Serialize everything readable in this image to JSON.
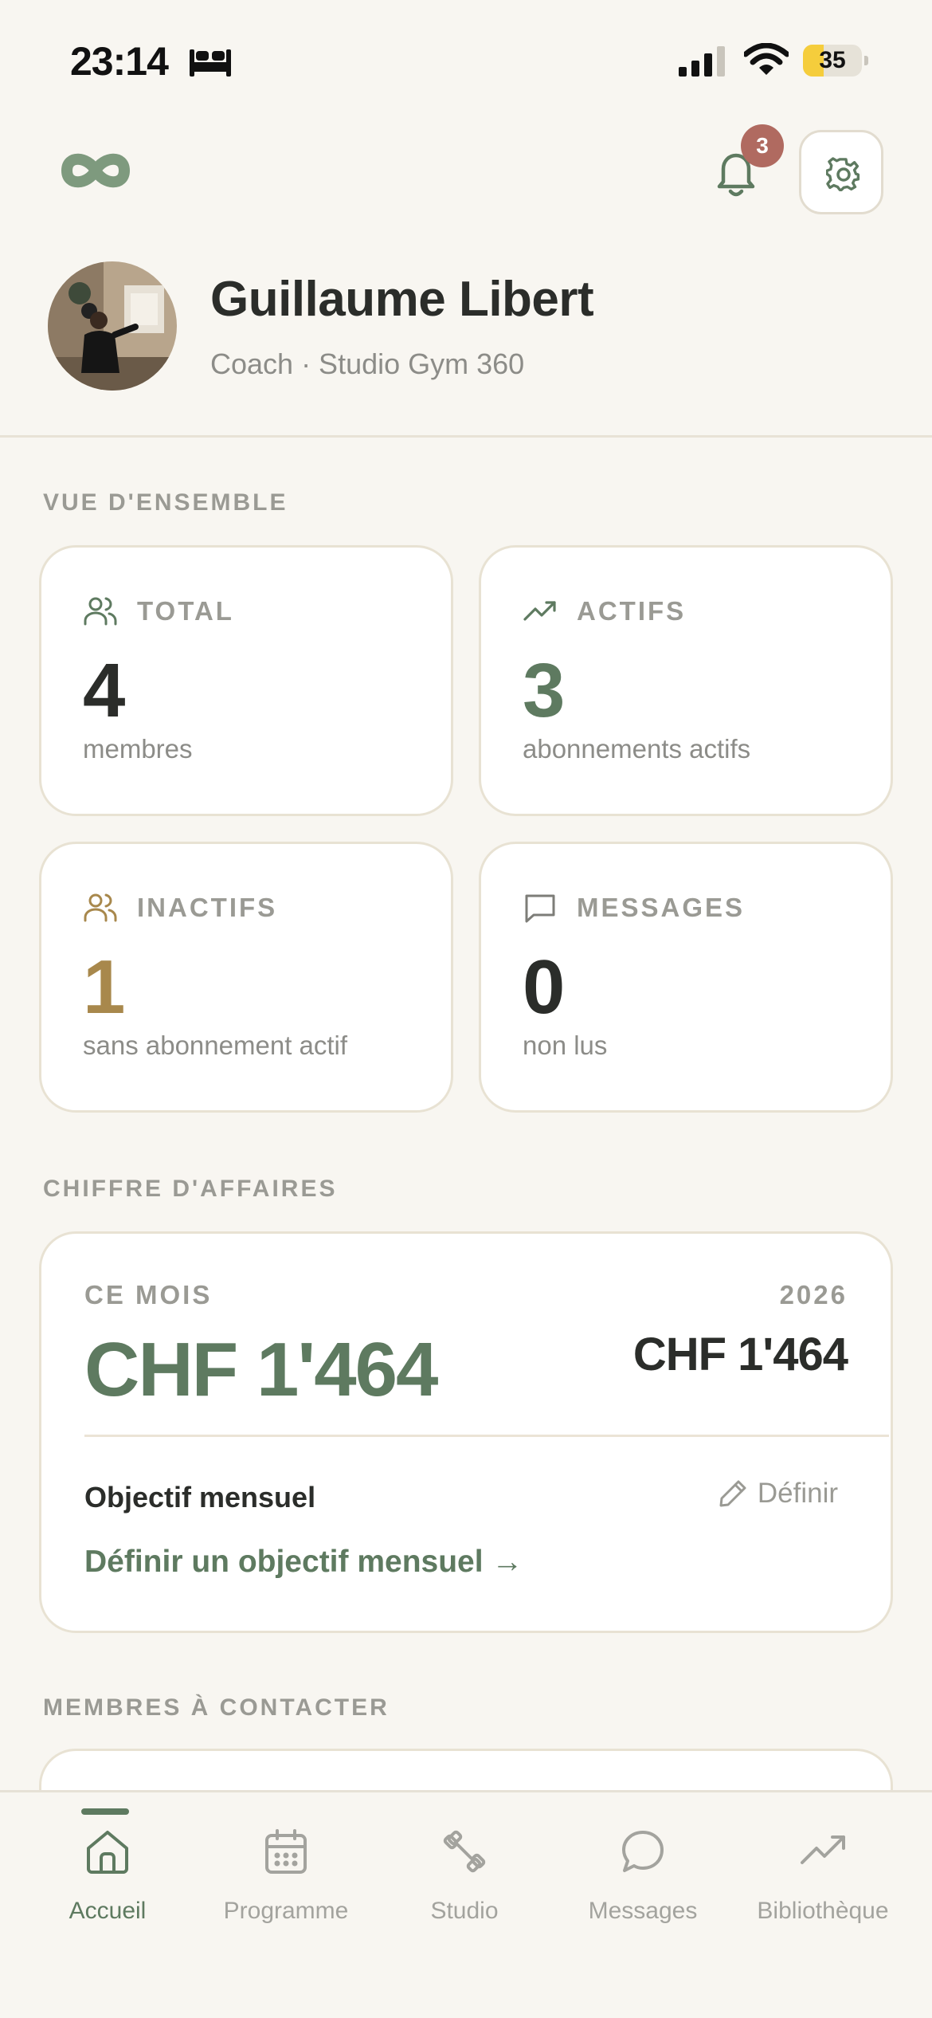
{
  "status_bar": {
    "time": "23:14",
    "battery": "35",
    "icons": [
      "bed-icon",
      "cellular-signal-icon",
      "wifi-icon",
      "battery-icon"
    ]
  },
  "header": {
    "logo": "infinity-logo-icon",
    "notifications_count": "3",
    "icons": [
      "bell-icon",
      "gear-icon"
    ]
  },
  "profile": {
    "name": "Guillaume Libert",
    "role": "Coach · Studio Gym 360"
  },
  "overview": {
    "section_title": "VUE D'ENSEMBLE",
    "stats": [
      {
        "icon": "users-icon",
        "label": "TOTAL",
        "value": "4",
        "sub": "membres",
        "color": "#2b2d2a",
        "icon_color": "#5e7a60"
      },
      {
        "icon": "trending-up-icon",
        "label": "ACTIFS",
        "value": "3",
        "sub": "abonnements actifs",
        "color": "#5e7a60",
        "icon_color": "#5e7a60"
      },
      {
        "icon": "users-icon",
        "label": "INACTIFS",
        "value": "1",
        "sub": "sans abonnement actif",
        "color": "#a8884c",
        "icon_color": "#a8884c"
      },
      {
        "icon": "message-square-icon",
        "label": "MESSAGES",
        "value": "0",
        "sub": "non lus",
        "color": "#2b2d2a",
        "icon_color": "#7d7d78"
      }
    ]
  },
  "revenue": {
    "section_title": "CHIFFRE D'AFFAIRES",
    "month_label": "CE MOIS",
    "month_value": "CHF 1'464",
    "year_label": "2026",
    "year_value": "CHF 1'464",
    "goal_title": "Objectif mensuel",
    "goal_edit_label": "Définir",
    "goal_link": "Définir un objectif mensuel →"
  },
  "contacts": {
    "section_title": "MEMBRES À CONTACTER"
  },
  "tabs": [
    {
      "label": "Accueil",
      "icon": "home-icon",
      "active": true
    },
    {
      "label": "Programme",
      "icon": "calendar-icon",
      "active": false
    },
    {
      "label": "Studio",
      "icon": "dumbbell-icon",
      "active": false
    },
    {
      "label": "Messages",
      "icon": "chat-bubble-icon",
      "active": false
    },
    {
      "label": "Bibliothèque",
      "icon": "trending-up-icon",
      "active": false
    }
  ],
  "colors": {
    "background": "#f8f6f1",
    "accent": "#5e7a60",
    "warning": "#a8884c",
    "badge": "#b06a60"
  }
}
